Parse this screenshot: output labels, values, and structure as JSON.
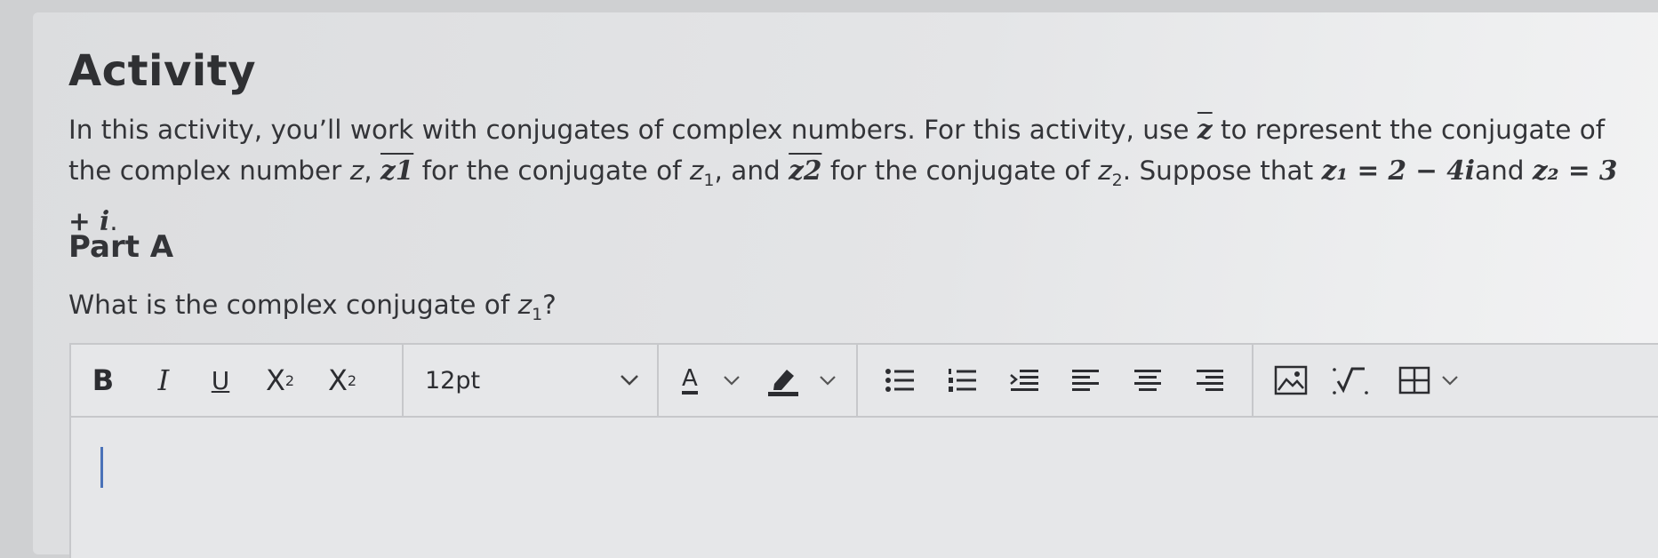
{
  "heading": "Activity",
  "intro": {
    "t1": "In this activity, you’ll work with conjugates of complex numbers. For this activity, use ",
    "zbar": "z",
    "t2": " to represent the conjugate of the complex number ",
    "z": "z",
    "t3": ", ",
    "z1bar": "z1",
    "t4": " for the conjugate of ",
    "z1": "z",
    "sub1": "1",
    "t5": ", and ",
    "z2bar": "z2",
    "t6": " for the conjugate of ",
    "z2": "z",
    "sub2": "2",
    "t7": ". Suppose that ",
    "eq1": "z₁ = 2 − 4i",
    "t8": "and ",
    "eq2": "z₂ = 3 + i",
    "t9": "."
  },
  "part_title": "Part A",
  "question": {
    "text": "What is the complex conjugate of ",
    "var": "z",
    "sub": "1",
    "end": "?"
  },
  "toolbar": {
    "bold": "B",
    "italic": "I",
    "underline": "U",
    "superscript_base": "X",
    "superscript_mark": "2",
    "subscript_base": "X",
    "subscript_mark": "2",
    "font_size": "12pt",
    "font_color_letter": "A"
  },
  "editor": {
    "value": ""
  }
}
